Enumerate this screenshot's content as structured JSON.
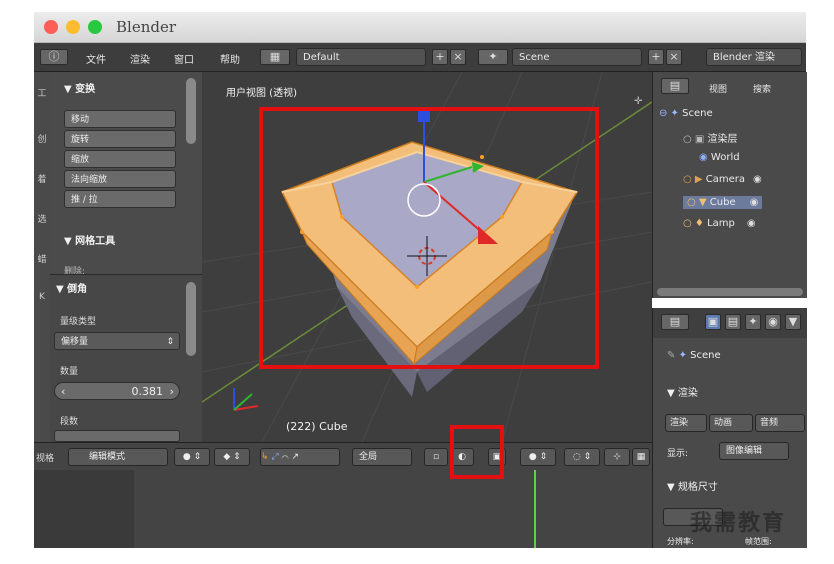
{
  "window": {
    "title": "Blender"
  },
  "menu": {
    "items": [
      "文件",
      "渲染",
      "窗口",
      "帮助"
    ],
    "layout": "Default",
    "scene": "Scene",
    "engine": "Blender 渲染"
  },
  "toolshelf": {
    "transform_header": "▼ 变换",
    "buttons": [
      "移动",
      "旋转",
      "缩放",
      "法向缩放",
      "推 / 拉"
    ],
    "mesh_tools_header": "▼ 网格工具",
    "mesh_tools_sub": "删除:",
    "bevel_header": "▼ 倒角",
    "amount_type_label": "量级类型",
    "amount_type_value": "偏移量",
    "amount_label": "数量",
    "amount_value": "0.381",
    "segments_label": "段数"
  },
  "viewport": {
    "view_label": "用户视图 (透视)",
    "object_label": "(222) Cube"
  },
  "viewport_header": {
    "view_menu": "视格",
    "mode": "编辑模式",
    "pivot": "全局"
  },
  "outliner": {
    "view": "视图",
    "search": "搜索",
    "items": [
      "Scene",
      "渲染层",
      "World",
      "Camera",
      "Cube",
      "Lamp"
    ]
  },
  "properties": {
    "scene": "Scene",
    "render_header": "▼ 渲染",
    "render_btn": "渲染",
    "anim_btn": "动画",
    "audio_btn": "音频",
    "display_label": "显示:",
    "display_value": "图像编辑",
    "dims_header": "▼ 规格尺寸",
    "resolution_label": "分辨率:",
    "frame_range_label": "帧范围:"
  },
  "watermark": "我需教育",
  "colors": {
    "highlight": "#e41010",
    "selection": "#f0a040",
    "viewport_bg": "#3e3e3e"
  }
}
